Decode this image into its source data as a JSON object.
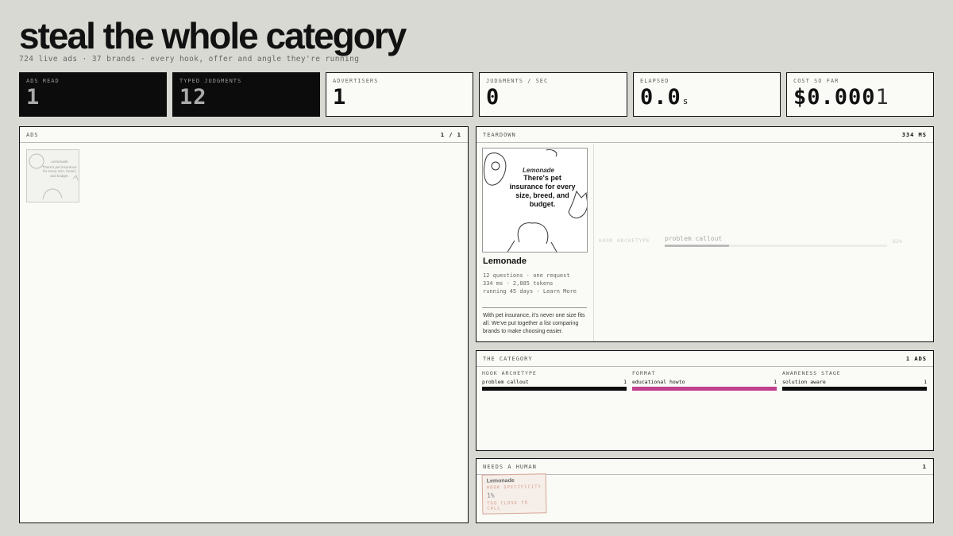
{
  "header": {
    "title": "steal the whole category",
    "subtitle": "724 live ads · 37 brands · every hook, offer and angle they're running"
  },
  "stats": [
    {
      "label": "ADS READ",
      "value": "1"
    },
    {
      "label": "TYPED JUDGMENTS",
      "value": "12"
    },
    {
      "label": "ADVERTISERS",
      "value": "1"
    },
    {
      "label": "JUDGMENTS / SEC",
      "value": "0"
    },
    {
      "label": "ELAPSED",
      "value": "0.0",
      "unit": "s"
    },
    {
      "label": "COST SO FAR",
      "value": "$0.000",
      "tail": "1"
    }
  ],
  "ads_panel": {
    "label": "ADS",
    "count": "1 / 1",
    "thumb": {
      "brand": "Lemonade",
      "text": "There's pet insurance for every size, breed, and budget."
    }
  },
  "teardown": {
    "label": "TEARDOWN",
    "timing": "334 MS",
    "card": {
      "brand_logo": "Lemonade",
      "headline": "There's pet insurance for every size, breed, and budget."
    },
    "brand": "Lemonade",
    "meta": [
      "12 questions · one request",
      "334 ms · 2,885 tokens",
      "running 45 days · Learn More"
    ],
    "body": "With pet insurance, it's never one size fits all. We've put together a list comparing brands to make choosing easier.",
    "hook": {
      "label": "HOOK ARCHETYPE",
      "value": "problem callout",
      "percent": "62%",
      "fill": 0.29
    }
  },
  "category": {
    "label": "THE CATEGORY",
    "count": "1 ADS",
    "columns": [
      {
        "label": "HOOK ARCHETYPE",
        "item": "problem callout",
        "count": "1",
        "color": "#0c0c0c"
      },
      {
        "label": "FORMAT",
        "item": "educational howto",
        "count": "1",
        "color": "#c2418f"
      },
      {
        "label": "AWARENESS STAGE",
        "item": "solution aware",
        "count": "1",
        "color": "#0c0c0c"
      }
    ]
  },
  "human": {
    "label": "NEEDS A HUMAN",
    "count": "1",
    "note": {
      "brand": "Lemonade",
      "field": "HOOK SPECIFICITY",
      "value": "1%",
      "flag": "TOO CLOSE TO CALL"
    }
  }
}
